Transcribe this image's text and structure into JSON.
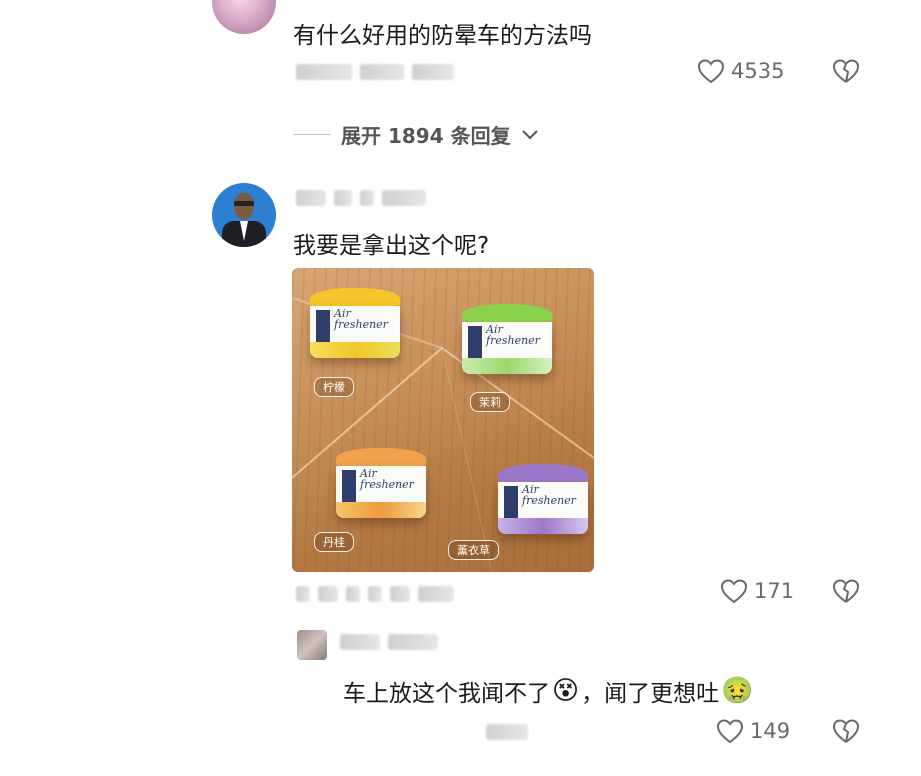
{
  "comments": [
    {
      "text": "有什么好用的防晕车的方法吗",
      "likes": "4535"
    },
    {
      "text": "我要是拿出这个呢?",
      "likes": "171",
      "image": {
        "products": [
          {
            "brand": "Air freshener",
            "label": "柠檬",
            "color": "#f3c62a"
          },
          {
            "brand": "Air freshener",
            "label": "茉莉",
            "color": "#8bd24a"
          },
          {
            "brand": "Air freshener",
            "label": "丹桂",
            "color": "#f0a24c"
          },
          {
            "brand": "Air freshener",
            "label": "薰衣草",
            "color": "#9b78c9"
          }
        ]
      }
    }
  ],
  "expand_replies": "展开 1894 条回复",
  "reply": {
    "text": "车上放这个我闻不了",
    "emoji1": "😵",
    "text2": "，闻了更想吐",
    "emoji2": "🤢",
    "likes": "149"
  },
  "icons": {
    "like": "heart-outline-icon",
    "dislike": "broken-heart-icon",
    "expand": "chevron-down-icon"
  }
}
